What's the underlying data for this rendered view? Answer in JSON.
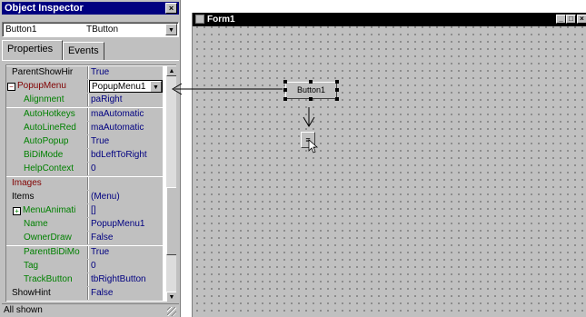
{
  "inspector": {
    "title": "Object Inspector",
    "close_glyph": "×",
    "selector": {
      "name": "Button1",
      "type": "TButton"
    },
    "tabs": [
      "Properties",
      "Events"
    ],
    "properties": [
      {
        "name": "ParentShowHir",
        "value": "True",
        "kind": "normal"
      },
      {
        "name": "PopupMenu",
        "value": "PopupMenu1",
        "kind": "selected",
        "expander": "−"
      },
      {
        "name": "Alignment",
        "value": "paRight",
        "kind": "sub"
      },
      {
        "name": "AutoHotkeys",
        "value": "maAutomatic",
        "kind": "sub"
      },
      {
        "name": "AutoLineRed",
        "value": "maAutomatic",
        "kind": "sub"
      },
      {
        "name": "AutoPopup",
        "value": "True",
        "kind": "sub"
      },
      {
        "name": "BiDiMode",
        "value": "bdLeftToRight",
        "kind": "sub"
      },
      {
        "name": "HelpContext",
        "value": "0",
        "kind": "sub"
      },
      {
        "name": "Images",
        "value": "",
        "kind": "red"
      },
      {
        "name": "Items",
        "value": "(Menu)",
        "kind": "normal"
      },
      {
        "name": "MenuAnimati",
        "value": "[]",
        "kind": "sub",
        "expander": "+"
      },
      {
        "name": "Name",
        "value": "PopupMenu1",
        "kind": "sub"
      },
      {
        "name": "OwnerDraw",
        "value": "False",
        "kind": "sub"
      },
      {
        "name": "ParentBiDiMo",
        "value": "True",
        "kind": "sub"
      },
      {
        "name": "Tag",
        "value": "0",
        "kind": "sub"
      },
      {
        "name": "TrackButton",
        "value": "tbRightButton",
        "kind": "sub"
      },
      {
        "name": "ShowHint",
        "value": "False",
        "kind": "normal"
      }
    ],
    "status": "All shown",
    "colors": {
      "titlebar": "#000080",
      "subprop": "#008000",
      "highlight": "#800000",
      "value": "#000080"
    }
  },
  "form": {
    "title": "Form1",
    "button_caption": "Button1",
    "popup_glyph": "≡",
    "window_buttons": [
      "_",
      "□",
      "×"
    ]
  },
  "icons": {
    "dropdown": "▼",
    "scroll_up": "▲",
    "scroll_down": "▼"
  }
}
